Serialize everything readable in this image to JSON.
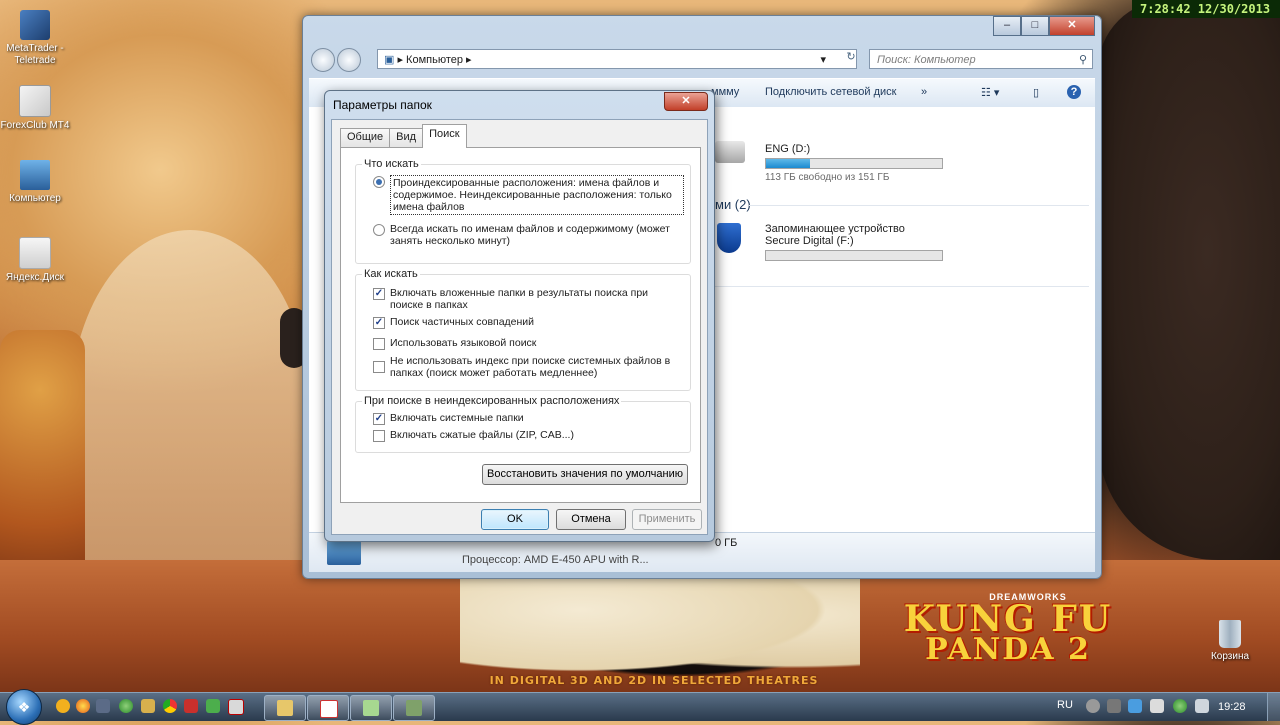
{
  "clock_overlay": "7:28:42  12/30/2013",
  "desktop": {
    "icons": [
      {
        "label": "MetaTrader - Teletrade",
        "icon": "metatrader-icon"
      },
      {
        "label": "ForexClub MT4",
        "icon": "forexclub-icon"
      },
      {
        "label": "Компьютер",
        "icon": "computer-icon"
      },
      {
        "label": "Яндекс.Диск",
        "icon": "yandex-disk-icon"
      }
    ],
    "recycle_bin": "Корзина",
    "wallpaper": {
      "brand_small": "DREAMWORKS",
      "title_line1": "KUNG FU",
      "title_line2": "PANDA",
      "number": "2",
      "tagline": "IN DIGITAL 3D AND 2D IN SELECTED THEATRES"
    }
  },
  "explorer": {
    "address": "Компьютер",
    "search_placeholder": "Поиск: Компьютер",
    "toolbar": {
      "partial": "ммму",
      "map_drive": "Подключить сетевой диск",
      "more": "»"
    },
    "drive_d": {
      "name": "ENG (D:)",
      "free": "113 ГБ свободно из 151 ГБ",
      "used_fraction": 0.25
    },
    "group_removable": "ми (2)",
    "sd_card": {
      "name_line1": "Запоминающее устройство",
      "name_line2": "Secure Digital (F:)"
    },
    "details": {
      "size_tail": "0 ГБ",
      "cpu": "Процессор: AMD E-450 APU with R..."
    }
  },
  "dialog": {
    "title": "Параметры папок",
    "close": "✕",
    "tabs": [
      "Общие",
      "Вид",
      "Поиск"
    ],
    "active_tab": "Поиск",
    "what_to_search": {
      "legend": "Что искать",
      "opt1": "Проиндексированные расположения: имена файлов и содержимое. Неиндексированные расположения: только имена файлов",
      "opt2": "Всегда искать по именам файлов и содержимому (может занять несколько минут)"
    },
    "how_to_search": {
      "legend": "Как искать",
      "opt1": "Включать вложенные папки в результаты поиска при поиске в папках",
      "opt2": "Поиск частичных совпадений",
      "opt3": "Использовать языковой поиск",
      "opt4": "Не использовать индекс при поиске системных файлов в папках (поиск может работать медленнее)"
    },
    "non_indexed": {
      "legend": "При поиске в неиндексированных расположениях",
      "opt1": "Включать системные папки",
      "opt2": "Включать сжатые файлы (ZIP, CAB...)"
    },
    "restore_defaults": "Восстановить значения по умолчанию",
    "ok": "OK",
    "cancel": "Отмена",
    "apply": "Применить"
  },
  "taskbar": {
    "lang": "RU",
    "time": "19:28"
  }
}
